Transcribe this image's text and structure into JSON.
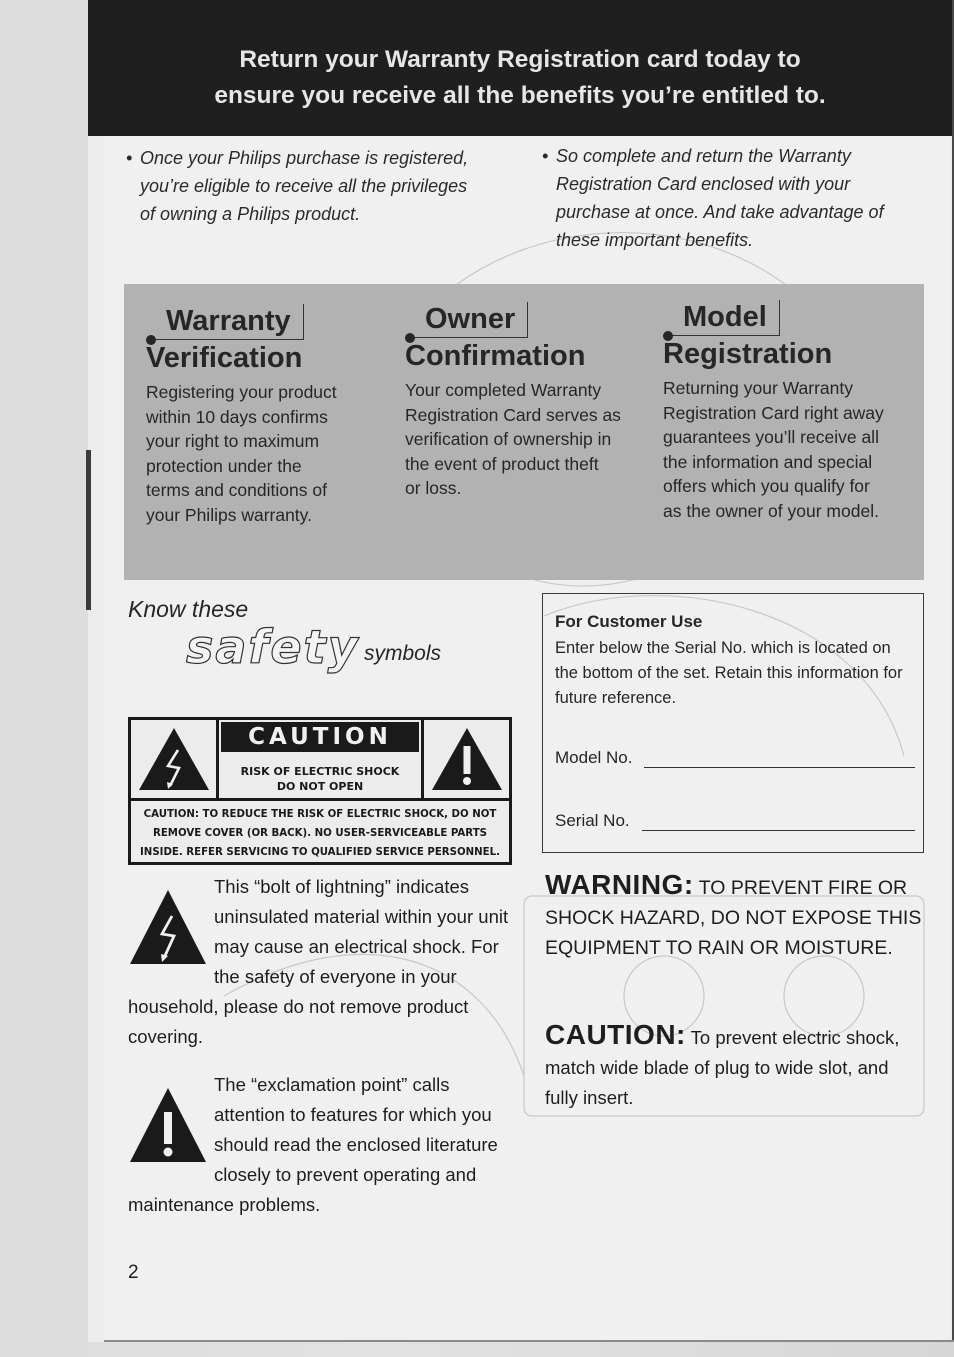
{
  "header": {
    "line1": "Return your Warranty Registration card today to",
    "line2": "ensure you receive all the benefits you’re entitled to."
  },
  "intro": {
    "left": {
      "bullet": "•",
      "lines": [
        "Once your Philips purchase is registered,",
        "you’re eligible to receive all the privileges",
        "of owning a Philips product."
      ]
    },
    "right": {
      "bullet": "•",
      "lines": [
        "So complete and return the Warranty",
        "Registration Card enclosed with your",
        "purchase at once. And take advantage of",
        "these important benefits."
      ]
    }
  },
  "benefits": [
    {
      "title_top": "Warranty",
      "title_bottom": "Verification",
      "lines": [
        "Registering your product",
        "within 10 days confirms",
        "your right to maximum",
        "protection under the",
        "terms and conditions of",
        "your Philips warranty."
      ]
    },
    {
      "title_top": "Owner",
      "title_bottom": "Confirmation",
      "lines": [
        "Your completed Warranty",
        "Registration Card serves as",
        "verification of ownership in",
        "the event of product theft",
        "or loss."
      ]
    },
    {
      "title_top": "Model",
      "title_bottom": "Registration",
      "lines": [
        "Returning your Warranty",
        "Registration Card right away",
        "guarantees you’ll receive all",
        "the information and special",
        "offers which you qualify for",
        "as the owner of your model."
      ]
    }
  ],
  "safety": {
    "know_these": "Know these",
    "safety_word": "safety",
    "symbols_word": "symbols"
  },
  "caution_label": {
    "title": "CAUTION",
    "risk_line1": "RISK OF ELECTRIC SHOCK",
    "risk_line2": "DO NOT OPEN",
    "notice_line1": "CAUTION: TO REDUCE THE RISK OF ELECTRIC SHOCK, DO NOT",
    "notice_line2": "REMOVE COVER (OR BACK). NO USER-SERVICEABLE PARTS",
    "notice_line3": "INSIDE. REFER SERVICING TO QUALIFIED SERVICE PERSONNEL.",
    "left_icon": "lightning-bolt-triangle",
    "right_icon": "exclamation-triangle"
  },
  "customer_use": {
    "title": "For Customer Use",
    "text": "Enter below the Serial No. which is located on the bottom of the set. Retain this information for future reference.",
    "model_label": "Model No.",
    "model_value": "",
    "serial_label": "Serial No.",
    "serial_value": ""
  },
  "symbol_explanations": {
    "bolt": "This “bolt of lightning” indicates uninsulated material within your unit may cause an electrical shock. For the safety of everyone in your household, please do not remove product covering.",
    "exclamation": "The “exclamation point” calls attention to features for which you should read the enclosed literature closely to prevent operating and maintenance problems."
  },
  "warning": {
    "label": "WARNING:",
    "text": " TO PREVENT FIRE OR SHOCK HAZARD, DO NOT EXPOSE THIS EQUIPMENT TO RAIN OR MOISTURE."
  },
  "caution_plug": {
    "label": "CAUTION:",
    "text": " To prevent electric shock, match wide blade of plug to wide slot, and fully insert."
  },
  "page_number": "2",
  "colors": {
    "banner": "#1f1f1f",
    "banner_text": "#e6e6e6",
    "benefits_band": "#b2b2b2",
    "page": "#f0f0f0",
    "ink": "#1e1e1e"
  }
}
